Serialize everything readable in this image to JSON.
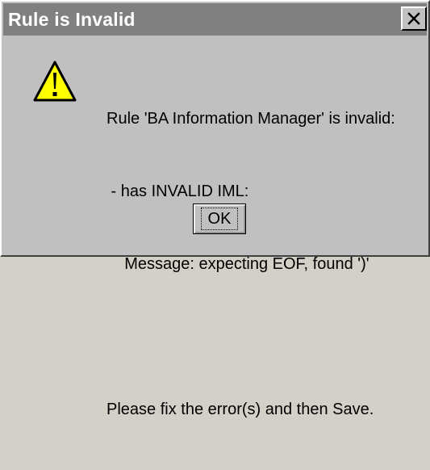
{
  "dialog": {
    "title": "Rule is Invalid",
    "close_icon": "close-icon",
    "warning_icon": "warning-icon",
    "colors": {
      "titlebar": "#808080",
      "title_text": "#ffffff",
      "face": "#c0c0c0",
      "warning_fill": "#ffff00"
    },
    "message": {
      "line1": "Rule 'BA Information Manager' is invalid:",
      "line2": " - has INVALID IML:",
      "line3": "    Message: expecting EOF, found ')'",
      "line4": "",
      "line5": "Please fix the error(s) and then Save."
    },
    "ok_label": "OK"
  }
}
